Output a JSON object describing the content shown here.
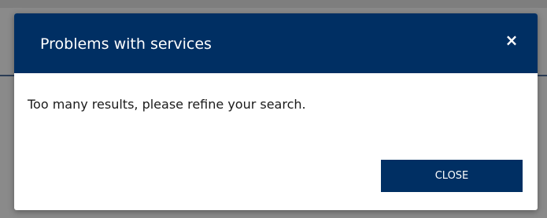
{
  "dialog": {
    "title": "Problems with services",
    "close_icon_glyph": "×",
    "message": "Too many results, please refine your search.",
    "close_button_label": "CLOSE"
  },
  "colors": {
    "header_background": "#002f63",
    "button_background": "#002f63",
    "backdrop": "#8a8a8a",
    "text_light": "#ffffff",
    "text_dark": "#1a1a1a"
  },
  "icons": {
    "close": "close-icon"
  }
}
